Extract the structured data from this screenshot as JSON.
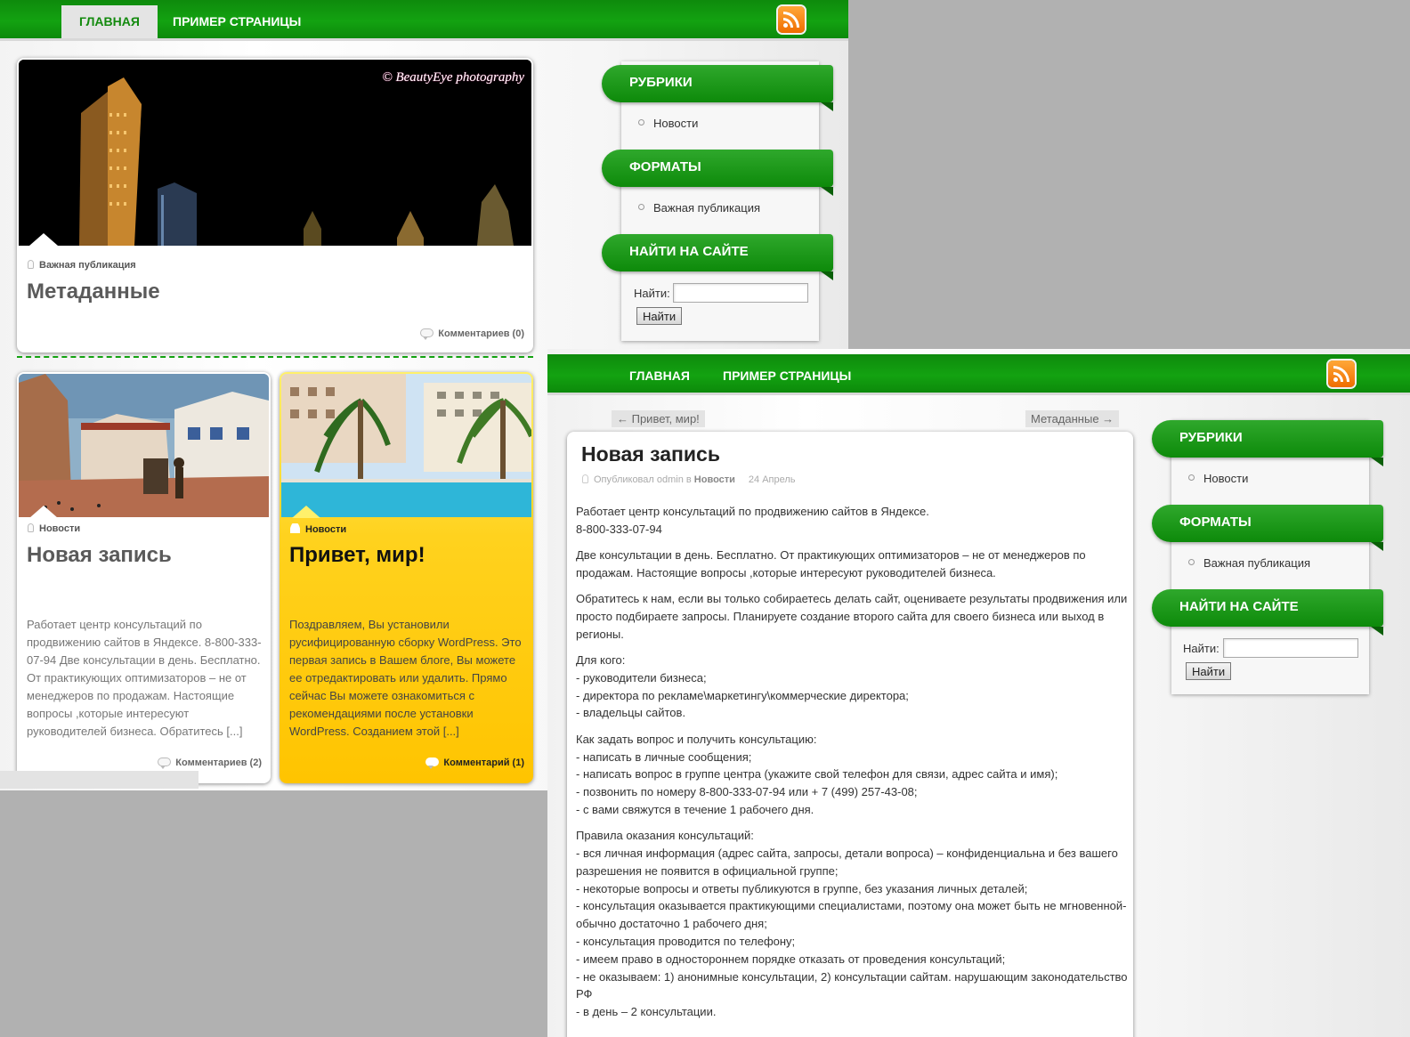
{
  "shot1": {
    "nav": {
      "home": "ГЛАВНАЯ",
      "sample": "ПРИМЕР СТРАНИЦЫ"
    },
    "featured": {
      "watermark": "© BeautyEye photography",
      "category": "Важная публикация",
      "title": "Метаданные",
      "comments": "Комментариев (0)"
    },
    "posts": [
      {
        "category": "Новости",
        "title": "Новая запись",
        "excerpt": "Работает центр консультаций по продвижению сайтов в Яндексе. 8-800-333-07-94 Две консультации в день. Бесплатно. От практикующих оптимизаторов – не от менеджеров по продажам. Настоящие вопросы ,которые интересуют руководителей бизнеса. Обратитесь [...]",
        "comments": "Комментариев (2)"
      },
      {
        "category": "Новости",
        "title": "Привет, мир!",
        "excerpt": "Поздравляем, Вы установили русифицированную сборку WordPress. Это первая запись в Вашем блоге, Вы можете ее отредактировать или удалить. Прямо сейчас Вы можете ознакомиться с рекомендациями после установки WordPress. Созданием этой [...]",
        "comments": "Комментарий (1)"
      }
    ]
  },
  "sidebar": {
    "rubrics_title": "РУБРИКИ",
    "rubrics_item": "Новости",
    "formats_title": "ФОРМАТЫ",
    "formats_item": "Важная публикация",
    "search_title": "НАЙТИ НА САЙТЕ",
    "search_label": "Найти:",
    "search_value": "",
    "search_button": "Найти"
  },
  "shot2": {
    "nav": {
      "home": "ГЛАВНАЯ",
      "sample": "ПРИМЕР СТРАНИЦЫ"
    },
    "prev": "← Привет, мир!",
    "next": "Метаданные →",
    "article": {
      "title": "Новая запись",
      "meta_by": "Опубликовал odmin в",
      "meta_cat": "Новости",
      "meta_date": "24 Апрель",
      "p1": [
        "Работает центр консультаций по продвижению сайтов в Яндексе.",
        "8-800-333-07-94"
      ],
      "p2": "Две консультации в день. Бесплатно. От практикующих оптимизаторов – не от менеджеров по продажам. Настоящие вопросы ,которые интересуют руководителей бизнеса.",
      "p3": "Обратитесь к нам, если вы только собираетесь делать сайт, оцениваете результаты продвижения или просто подбираете запросы. Планируете создание второго сайта для своего бизнеса или выход в регионы.",
      "p4": [
        "Для кого:",
        "- руководители бизнеса;",
        "- директора по рекламе\\маркетингу\\коммерческие директора;",
        "- владельцы сайтов."
      ],
      "p5": [
        "Как задать вопрос и получить консультацию:",
        "- написать в личные сообщения;",
        "- написать вопрос в группе центра (укажите свой телефон для связи, адрес сайта и имя);",
        "- позвонить по номеру 8-800-333-07-94 или + 7 (499) 257-43-08;",
        "- с вами свяжутся в течение 1 рабочего дня."
      ],
      "p6": [
        "Правила оказания консультаций:",
        "- вся личная информация (адрес сайта, запросы, детали вопроса) – конфиденциальна и без вашего разрешения не появится в официальной группе;",
        "- некоторые вопросы и ответы публикуются в группе, без указания личных деталей;",
        "- консультация оказывается практикующими специалистами, поэтому она может быть не мгновенной- обычно достаточно 1 рабочего дня;",
        "- консультация проводится по телефону;",
        "- имеем право в одностороннем порядке отказать от проведения консультаций;",
        "- не оказываем: 1) анонимные консультации, 2) консультации сайтам. нарушающим законодательство РФ",
        "- в день – 2 консультации."
      ]
    }
  }
}
